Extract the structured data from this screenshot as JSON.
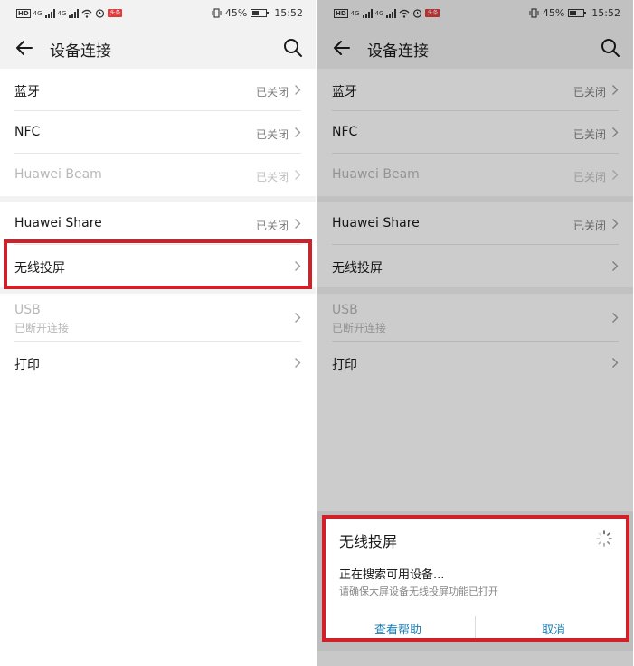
{
  "status_bar": {
    "hd": "HD",
    "net1": "4G",
    "net2": "4G",
    "tag": "头条",
    "battery_percent": "45%",
    "battery_level": 0.45,
    "time": "15:52"
  },
  "app_bar": {
    "title": "设备连接",
    "back_icon": "arrow-left-icon",
    "search_icon": "search-icon"
  },
  "settings": {
    "bluetooth": {
      "label": "蓝牙",
      "status": "已关闭"
    },
    "nfc": {
      "label": "NFC",
      "status": "已关闭"
    },
    "huawei_beam": {
      "label": "Huawei Beam",
      "status": "已关闭",
      "disabled": true
    },
    "huawei_share": {
      "label": "Huawei Share",
      "status": "已关闭"
    },
    "wireless_projection": {
      "label": "无线投屏"
    },
    "usb": {
      "label": "USB",
      "sub": "已断开连接",
      "disabled": true
    },
    "print": {
      "label": "打印"
    }
  },
  "dialog": {
    "title": "无线投屏",
    "message": "正在搜索可用设备...",
    "hint": "请确保大屏设备无线投屏功能已打开",
    "help_label": "查看帮助",
    "cancel_label": "取消"
  },
  "colors": {
    "highlight": "#d0202a",
    "accent": "#1a7fb5"
  }
}
